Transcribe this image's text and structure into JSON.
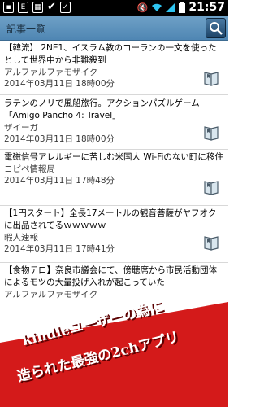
{
  "status_bar": {
    "time": "21:57",
    "icons": [
      "notification-icon",
      "mail-icon",
      "calendar-icon",
      "check-icon",
      "checkbox-icon",
      "mute-icon",
      "wifi-icon",
      "signal-icon",
      "battery-icon"
    ]
  },
  "app_bar": {
    "title": "記事一覧",
    "search_icon": "search-icon"
  },
  "articles": [
    {
      "headline": "【韓流】 2NE1、イスラム教のコーランの一文を使ったとして世界中から非難殺到",
      "source": "アルファルファモザイク",
      "date": "2014年03月11日 18時00分"
    },
    {
      "headline": "ラテンのノリで風船旅行。アクションパズルゲーム「Amigo Pancho 4: Travel」",
      "source": "ザイーガ",
      "date": "2014年03月11日 18時00分"
    },
    {
      "headline": "電磁信号アレルギーに苦しむ米国人 Wi-Fiのない町に移住",
      "source": "コピペ情報局",
      "date": "2014年03月11日 17時48分"
    },
    {
      "headline": "【1円スタート】全長17メートルの観音菩薩がヤフオクに出品されてるｗｗｗｗｗ",
      "source": "暇人速報",
      "date": "2014年03月11日 17時41分"
    },
    {
      "headline": "【食物テロ】奈良市議会にて、傍聴席から市民活動団体によるモツの大量投げ入れが起こっていた",
      "source": "アルファルファモザイク",
      "date": ""
    }
  ],
  "overlay": {
    "line1": "kindleユーザーの為に",
    "line2": "造られた最強の2chアプリ",
    "color": "#d41a1a"
  }
}
